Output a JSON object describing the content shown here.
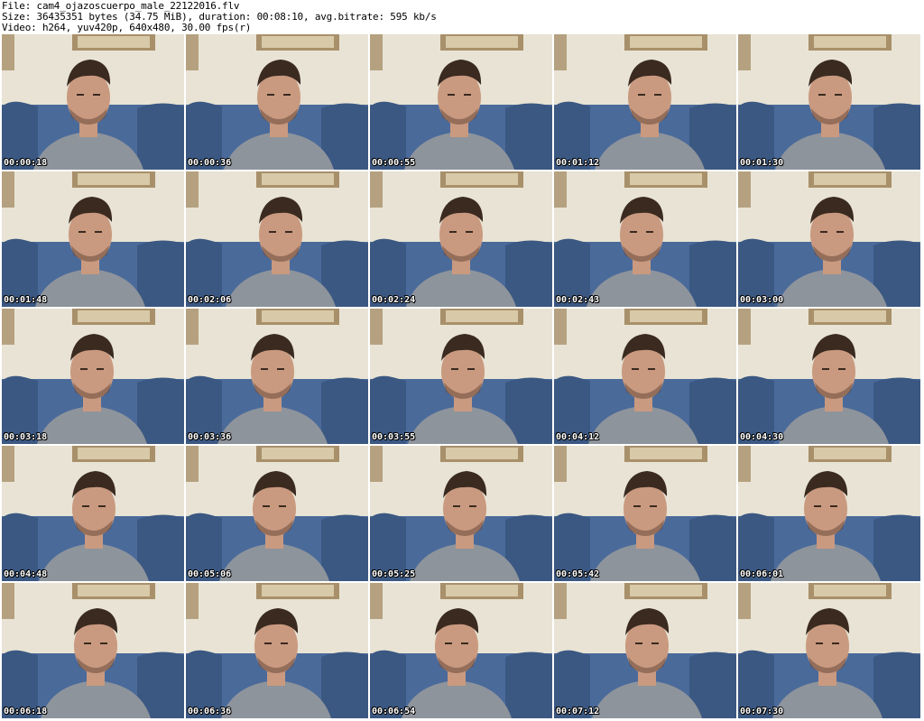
{
  "header": {
    "file_line": "File: cam4_ojazoscuerpo_male_22122016.flv",
    "size_line": "Size: 36435351 bytes (34.75 MiB), duration: 00:08:10, avg.bitrate: 595 kb/s",
    "video_line": "Video: h264, yuv420p, 640x480, 30.00 fps(r)"
  },
  "thumbnails": [
    {
      "timestamp": "00:00:18"
    },
    {
      "timestamp": "00:00:36"
    },
    {
      "timestamp": "00:00:55"
    },
    {
      "timestamp": "00:01:12"
    },
    {
      "timestamp": "00:01:30"
    },
    {
      "timestamp": "00:01:48"
    },
    {
      "timestamp": "00:02:06"
    },
    {
      "timestamp": "00:02:24"
    },
    {
      "timestamp": "00:02:43"
    },
    {
      "timestamp": "00:03:00"
    },
    {
      "timestamp": "00:03:18"
    },
    {
      "timestamp": "00:03:36"
    },
    {
      "timestamp": "00:03:55"
    },
    {
      "timestamp": "00:04:12"
    },
    {
      "timestamp": "00:04:30"
    },
    {
      "timestamp": "00:04:48"
    },
    {
      "timestamp": "00:05:06"
    },
    {
      "timestamp": "00:05:25"
    },
    {
      "timestamp": "00:05:42"
    },
    {
      "timestamp": "00:06:01"
    },
    {
      "timestamp": "00:06:18"
    },
    {
      "timestamp": "00:06:36"
    },
    {
      "timestamp": "00:06:54"
    },
    {
      "timestamp": "00:07:12"
    },
    {
      "timestamp": "00:07:30"
    }
  ],
  "colors": {
    "wall": "#e8e3d4",
    "couch": "#4a6a9a",
    "couch_dark": "#3b5882",
    "skin": "#c99a80",
    "hair": "#3a2a20",
    "shirt": "#8e949c",
    "frame": "#a8906a"
  }
}
